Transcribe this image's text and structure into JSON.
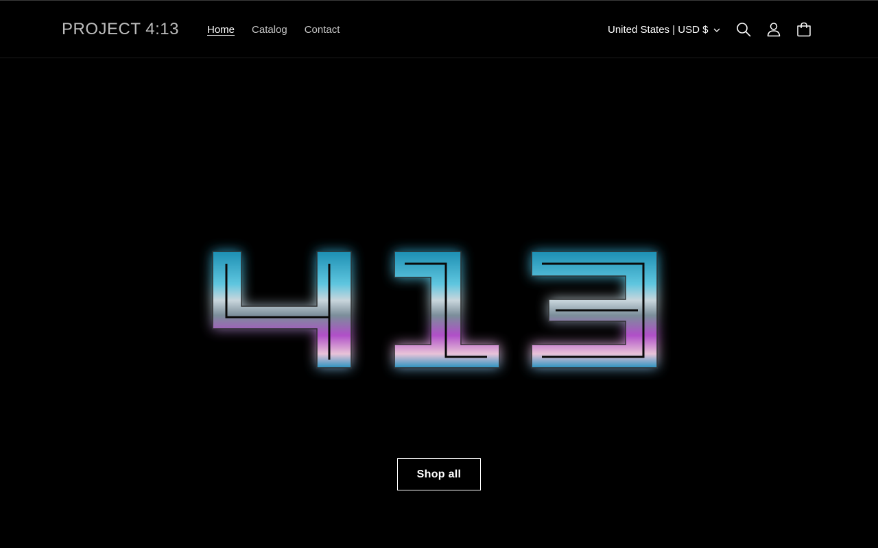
{
  "header": {
    "logo": "PROJECT 4:13",
    "nav": [
      {
        "label": "Home",
        "active": true
      },
      {
        "label": "Catalog",
        "active": false
      },
      {
        "label": "Contact",
        "active": false
      }
    ],
    "locale": "United States | USD $",
    "icons": [
      "search-icon",
      "account-icon",
      "cart-icon"
    ]
  },
  "hero": {
    "logo_text": "413",
    "button_label": "Shop all"
  },
  "colors": {
    "background": "#000000",
    "text": "#ffffff",
    "nav_text": "#c7c7c7",
    "logo_text": "#bdbdbd",
    "glow_cyan": "#2aa7c9",
    "glow_magenta": "#c23bd6"
  }
}
